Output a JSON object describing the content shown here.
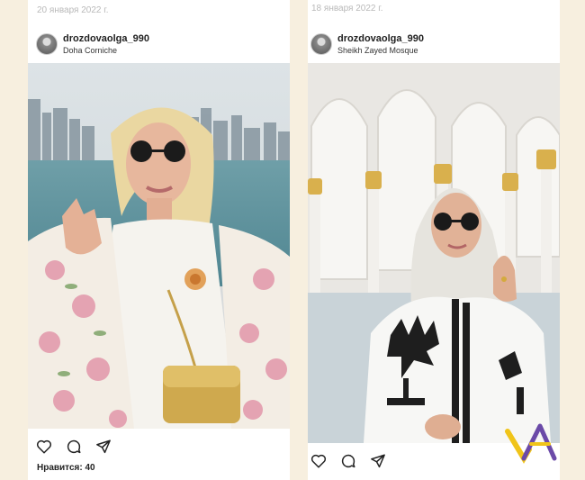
{
  "post_left": {
    "date": "20 января 2022 г.",
    "username": "drozdovaolga_990",
    "location": "Doha Corniche",
    "likes_text": "Нравится: 40"
  },
  "post_right": {
    "date": "18 января 2022 г.",
    "username": "drozdovaolga_990",
    "location": "Sheikh Zayed Mosque"
  },
  "icons": [
    "heart-icon",
    "comment-icon",
    "share-icon"
  ],
  "colors": {
    "side_band": "#f7efdf",
    "username": "#222222",
    "date": "#b9b9b9",
    "watermark_yellow": "#f0c419",
    "watermark_purple": "#6b4aa8"
  }
}
